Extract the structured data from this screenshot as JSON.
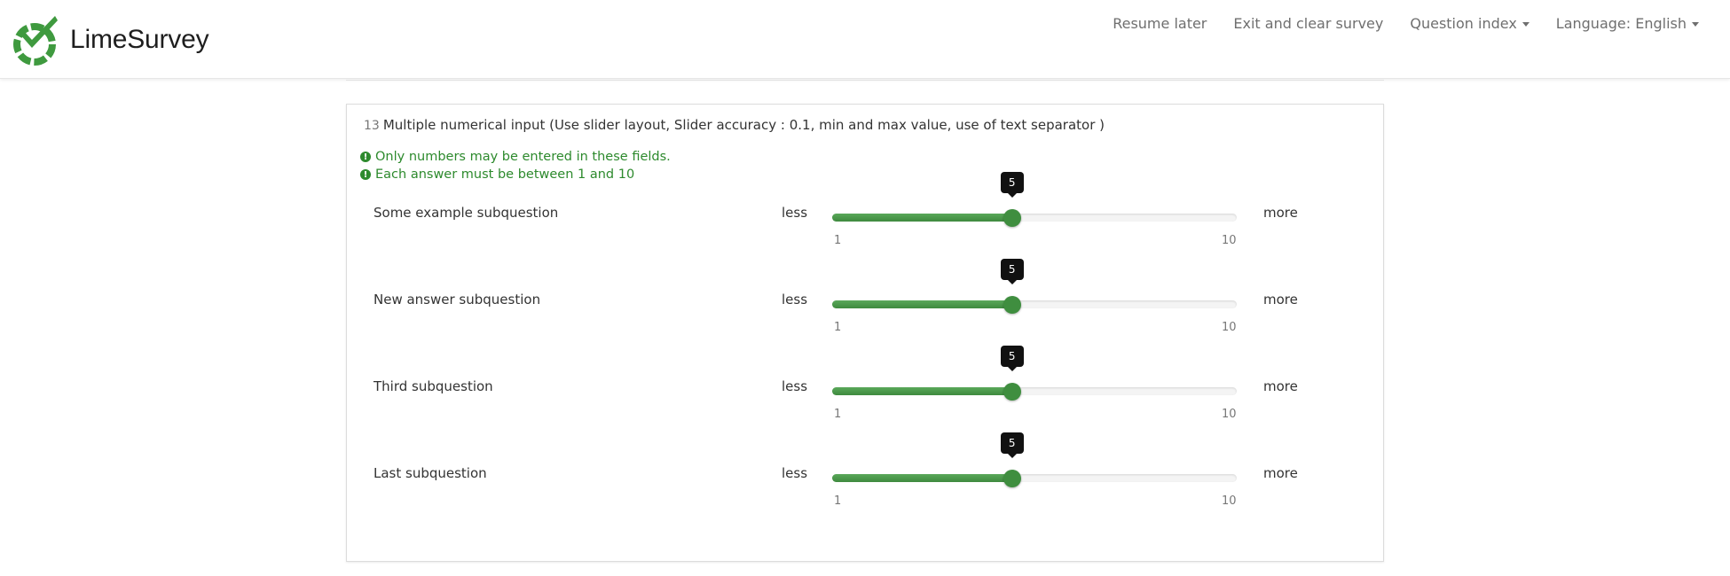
{
  "navbar": {
    "brand": "LimeSurvey",
    "items": [
      {
        "label": "Resume later"
      },
      {
        "label": "Exit and clear survey"
      },
      {
        "label": "Question index"
      },
      {
        "label": "Language: English"
      }
    ]
  },
  "question": {
    "number": "13",
    "text": "Multiple numerical input (Use slider layout, Slider accuracy : 0.1, min and max value, use of text separator )",
    "tips": [
      "Only numbers may be entered in these fields.",
      "Each answer must be between 1 and 10"
    ],
    "subquestions": [
      {
        "label": "Some example subquestion",
        "left_text": "less",
        "right_text": "more",
        "value": "5",
        "min": "1",
        "max": "10"
      },
      {
        "label": "New answer subquestion",
        "left_text": "less",
        "right_text": "more",
        "value": "5",
        "min": "1",
        "max": "10"
      },
      {
        "label": "Third subquestion",
        "left_text": "less",
        "right_text": "more",
        "value": "5",
        "min": "1",
        "max": "10"
      },
      {
        "label": "Last subquestion",
        "left_text": "less",
        "right_text": "more",
        "value": "5",
        "min": "1",
        "max": "10"
      }
    ]
  },
  "colors": {
    "accent_green": "#3f8e3f",
    "tip_green": "#2d8a2d",
    "nav_text": "#6f6f6f"
  }
}
